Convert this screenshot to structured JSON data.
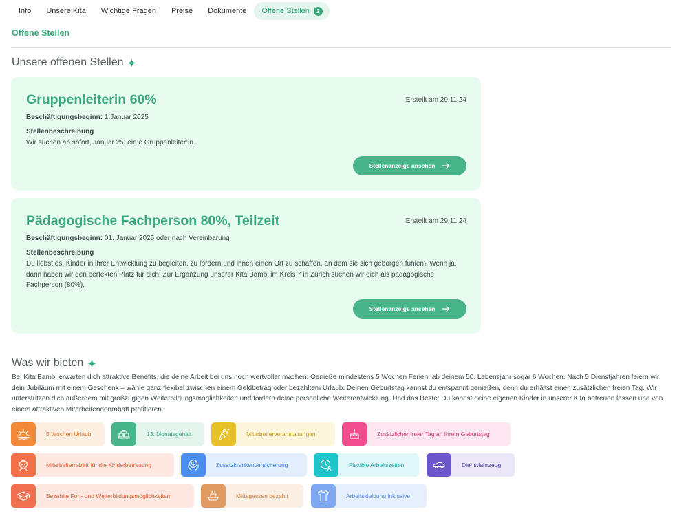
{
  "tabs": [
    {
      "label": "Info"
    },
    {
      "label": "Unsere Kita"
    },
    {
      "label": "Wichtige Fragen"
    },
    {
      "label": "Preise"
    },
    {
      "label": "Dokumente"
    },
    {
      "label": "Offene Stellen",
      "count": "2"
    }
  ],
  "section_title": "Offene Stellen",
  "jobs_heading": "Unsere offenen Stellen",
  "jobs": [
    {
      "title": "Gruppenleiterin 60%",
      "created": "Erstellt am 29.11.24",
      "start_label": "Beschäftigungsbeginn:",
      "start_value": " 1.Januar 2025",
      "desc_label": "Stellenbeschreibung",
      "description": "Wir suchen ab sofort, Januar 25, ein:e Gruppenleiter:in.",
      "button": "Stellenanzeige ansehen"
    },
    {
      "title": "Pädagogische Fachperson 80%, Teilzeit",
      "created": "Erstellt am 29.11.24",
      "start_label": "Beschäftigungsbeginn:",
      "start_value": " 01. Januar 2025 oder nach Vereinbarung",
      "desc_label": "Stellenbeschreibung",
      "description": "Du liebst es, Kinder in ihrer Entwicklung zu begleiten, zu fördern und ihnen einen Ort zu schaffen, an dem sie sich geborgen fühlen? Wenn ja, dann haben wir den perfekten Platz für dich! Zur Ergänzung unserer Kita Bambi im Kreis 7 in Zürich suchen wir dich als pädagogische Fachperson (80%).",
      "button": "Stellenanzeige ansehen"
    }
  ],
  "benefits_heading": "Was wir bieten",
  "benefits_text": "Bei Kita Bambi erwarten dich attraktive Benefits, die deine Arbeit bei uns noch wertvoller machen: Genieße mindestens 5 Wochen Ferien, ab deinem 50. Lebensjahr sogar 6 Wochen. Nach 5 Dienstjahren feiern wir dein Jubiläum mit einem Geschenk – wähle ganz flexibel zwischen einem Geldbetrag oder bezahltem Urlaub. Deinen Geburtstag kannst du entspannt genießen, denn du erhältst einen zusätzlichen freien Tag. Wir unterstützen dich außerdem mit großzügigen Weiterbildungsmöglichkeiten und fördern deine persönliche Weiterentwicklung. Und das Beste: Du kannst deine eigenen Kinder in unserer Kita betreuen lassen und von einem attraktiven Mitarbeitendenrabatt profitieren.",
  "benefits": [
    {
      "label": "5 Wochen Urlaub",
      "icon": "sun-beach-icon",
      "color": "#f28a3a",
      "bg": "#fdeee2",
      "text": "#e2772a"
    },
    {
      "label": "13. Monatsgehalt",
      "icon": "money-stack-icon",
      "color": "#47b48a",
      "bg": "#e3f5ec",
      "text": "#3aaa7c"
    },
    {
      "label": "Mitarbeiterveranstaltungen",
      "icon": "party-icon",
      "color": "#e8c02a",
      "bg": "#fdf6dd",
      "text": "#c9a21a"
    },
    {
      "label": "Zusätzlicher freier Tag an Ihrem Geburtstag",
      "icon": "cake-icon",
      "color": "#ef4d8e",
      "bg": "#fde6ef",
      "text": "#d83a78"
    },
    {
      "label": "Mitarbeiterrabatt für die Kinderbetreuung",
      "icon": "child-face-icon",
      "color": "#f2704a",
      "bg": "#fde8e1",
      "text": "#e0603a"
    },
    {
      "label": "Zusatzkrankenversicherung",
      "icon": "care-hands-icon",
      "color": "#4a8ff0",
      "bg": "#e3eefd",
      "text": "#3a7fe0"
    },
    {
      "label": "Flexible Arbeitszeiten",
      "icon": "clock-person-icon",
      "color": "#1dc4c8",
      "bg": "#dff7f7",
      "text": "#14a9ad"
    },
    {
      "label": "Dienstfahrzeug",
      "icon": "car-icon",
      "color": "#6b57c9",
      "bg": "#ebe7f8",
      "text": "#4a3fa0"
    },
    {
      "label": "Bezahlte Fort- und Weiterbildungsmöglichkeiten",
      "icon": "graduation-cap-icon",
      "color": "#f27050",
      "bg": "#fde8e1",
      "text": "#e0603a"
    },
    {
      "label": "Mittagessen bezahlt",
      "icon": "lunch-icon",
      "color": "#df9a62",
      "bg": "#fbeee2",
      "text": "#c9823f"
    },
    {
      "label": "Arbeitskleidung inklusive",
      "icon": "shirt-icon",
      "color": "#7ea9f2",
      "bg": "#e6effd",
      "text": "#5a8ee4"
    }
  ]
}
